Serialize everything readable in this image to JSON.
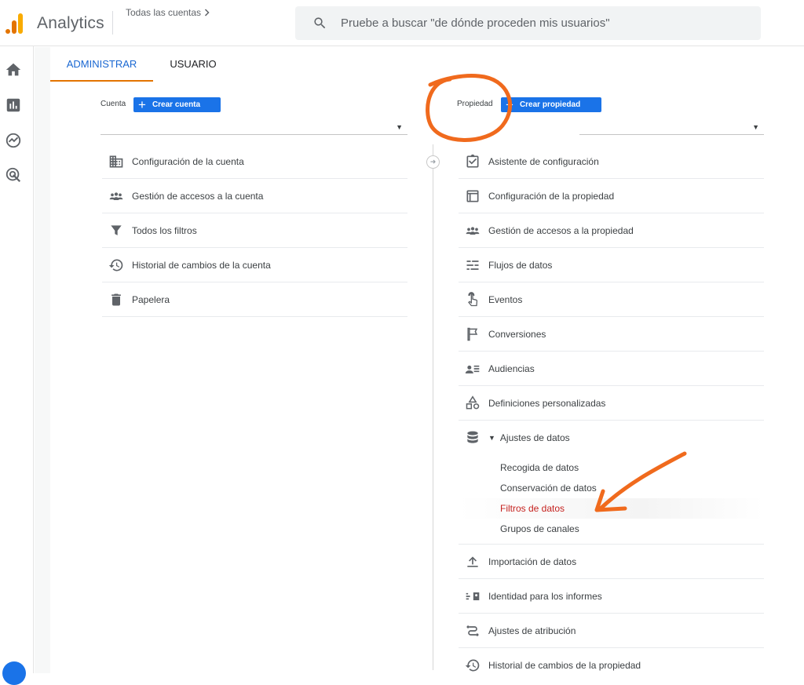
{
  "app": {
    "name": "Analytics",
    "accounts_breadcrumb": "Todas las cuentas"
  },
  "search": {
    "placeholder": "Pruebe a buscar \"de dónde proceden mis usuarios\""
  },
  "tabs": [
    {
      "label": "ADMINISTRAR",
      "active": true
    },
    {
      "label": "USUARIO",
      "active": false
    }
  ],
  "account": {
    "label": "Cuenta",
    "create_button": "Crear cuenta",
    "items": [
      {
        "label": "Configuración de la cuenta",
        "icon": "building-icon"
      },
      {
        "label": "Gestión de accesos a la cuenta",
        "icon": "people-icon"
      },
      {
        "label": "Todos los filtros",
        "icon": "filter-icon"
      },
      {
        "label": "Historial de cambios de la cuenta",
        "icon": "history-icon"
      },
      {
        "label": "Papelera",
        "icon": "trash-icon"
      }
    ]
  },
  "property": {
    "label": "Propiedad",
    "create_button": "Crear propiedad",
    "items": [
      {
        "label": "Asistente de configuración",
        "icon": "checklist-icon"
      },
      {
        "label": "Configuración de la propiedad",
        "icon": "layout-icon"
      },
      {
        "label": "Gestión de accesos a la propiedad",
        "icon": "people-icon"
      },
      {
        "label": "Flujos de datos",
        "icon": "streams-icon"
      },
      {
        "label": "Eventos",
        "icon": "touch-icon"
      },
      {
        "label": "Conversiones",
        "icon": "flag-icon"
      },
      {
        "label": "Audiencias",
        "icon": "audience-icon"
      },
      {
        "label": "Definiciones personalizadas",
        "icon": "shapes-icon"
      },
      {
        "label": "Ajustes de datos",
        "icon": "database-icon"
      }
    ],
    "data_settings_sub": [
      {
        "label": "Recogida de datos",
        "active": false
      },
      {
        "label": "Conservación de datos",
        "active": false
      },
      {
        "label": "Filtros de datos",
        "active": true
      },
      {
        "label": "Grupos de canales",
        "active": false
      }
    ],
    "items_after": [
      {
        "label": "Importación de datos",
        "icon": "upload-icon"
      },
      {
        "label": "Identidad para los informes",
        "icon": "identity-icon"
      },
      {
        "label": "Ajustes de atribución",
        "icon": "attribution-icon"
      },
      {
        "label": "Historial de cambios de la propiedad",
        "icon": "history-icon"
      }
    ]
  },
  "colors": {
    "accent_blue": "#1a73e8",
    "tab_orange": "#e37400",
    "active_red": "#c5221f",
    "annotation_orange": "#f06a1d"
  }
}
